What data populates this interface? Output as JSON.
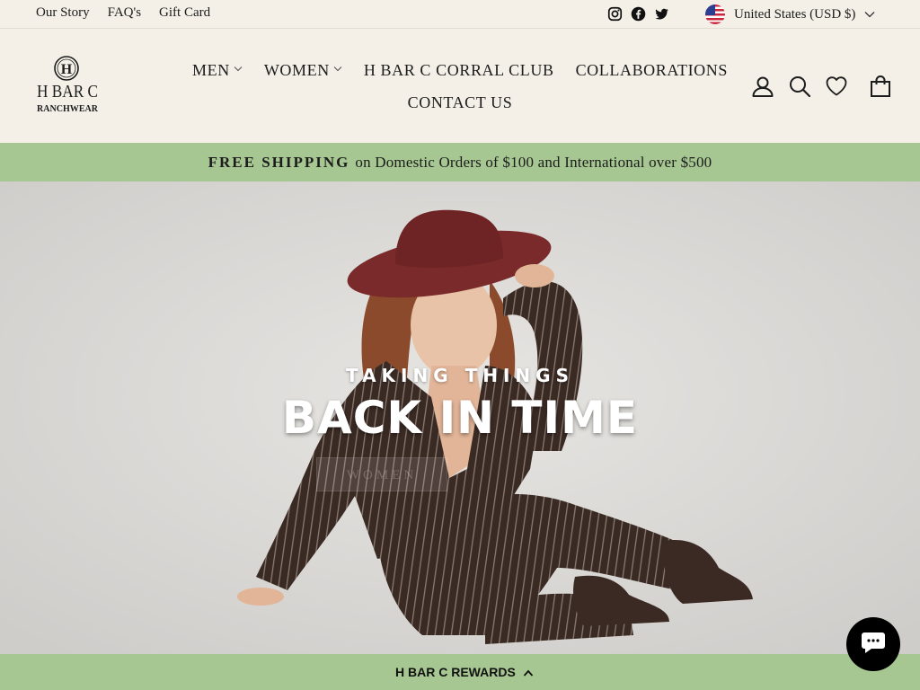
{
  "utility": {
    "links": [
      "Our Story",
      "FAQ's",
      "Gift Card"
    ],
    "social_icons": [
      "instagram-icon",
      "facebook-icon",
      "twitter-icon"
    ],
    "currency": "United States (USD $)"
  },
  "header": {
    "logo": {
      "line1": "H BAR C",
      "line2": "RANCHWEAR"
    },
    "nav_row1": [
      {
        "label": "MEN",
        "dropdown": true
      },
      {
        "label": "WOMEN",
        "dropdown": true
      },
      {
        "label": "H BAR C CORRAL CLUB",
        "dropdown": false
      },
      {
        "label": "COLLABORATIONS",
        "dropdown": false
      }
    ],
    "nav_row2": [
      {
        "label": "CONTACT US",
        "dropdown": false
      }
    ],
    "icons": [
      "account-icon",
      "search-icon",
      "heart-icon",
      "bag-icon"
    ]
  },
  "announcement": {
    "bold": "FREE SHIPPING",
    "text": "on Domestic Orders of $100 and International over $500"
  },
  "hero": {
    "kicker": "TAKING THINGS",
    "headline": "BACK IN TIME",
    "cta": "WOMEN"
  },
  "rewards": {
    "label": "H BAR C REWARDS"
  },
  "colors": {
    "background": "#f4f0e8",
    "announcement_bg": "#a7c792",
    "hat": "#7a2a2a",
    "suit": "#3a2a24"
  }
}
